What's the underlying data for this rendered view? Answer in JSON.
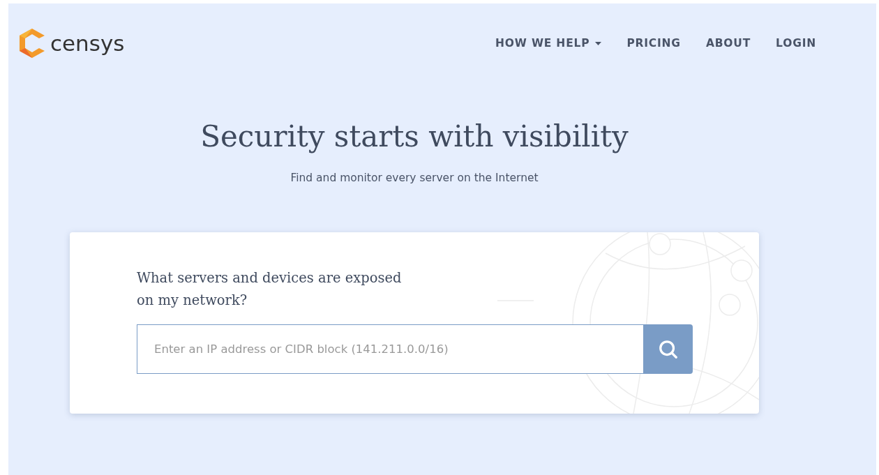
{
  "header": {
    "logo": "censys",
    "nav": [
      {
        "label": "HOW WE HELP",
        "kind": "dropdown"
      },
      {
        "label": "PRICING",
        "kind": "link"
      },
      {
        "label": "ABOUT",
        "kind": "link"
      },
      {
        "label": "LOGIN",
        "kind": "link"
      }
    ]
  },
  "hero": {
    "title": "Security starts with visibility",
    "subtitle": "Find and monitor every server on the Internet"
  },
  "search_card": {
    "question": "What servers and devices are exposed\non my network?",
    "placeholder": "Enter an IP address or CIDR block (141.211.0.0/16)"
  }
}
